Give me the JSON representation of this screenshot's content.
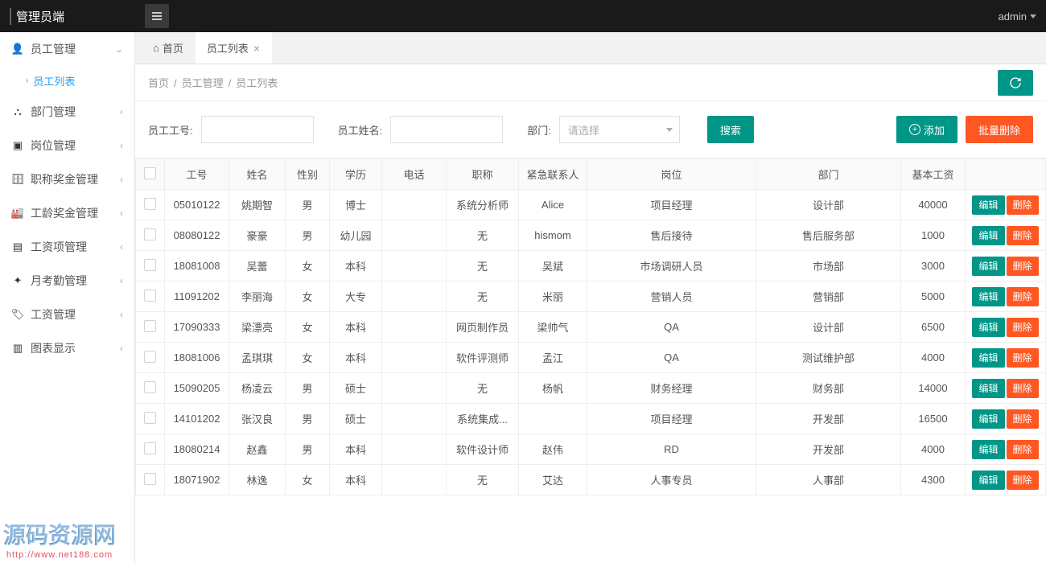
{
  "header": {
    "brand": "管理员端",
    "user": "admin"
  },
  "sidebar": {
    "items": [
      {
        "label": "员工管理",
        "expanded": true
      },
      {
        "label": "部门管理"
      },
      {
        "label": "岗位管理"
      },
      {
        "label": "职称奖金管理"
      },
      {
        "label": "工龄奖金管理"
      },
      {
        "label": "工资项管理"
      },
      {
        "label": "月考勤管理"
      },
      {
        "label": "工资管理"
      },
      {
        "label": "图表显示"
      }
    ],
    "sub": {
      "label": "员工列表"
    }
  },
  "tabs": {
    "home": "首页",
    "current": "员工列表"
  },
  "breadcrumb": {
    "a": "首页",
    "b": "员工管理",
    "c": "员工列表"
  },
  "filters": {
    "id_label": "员工工号:",
    "name_label": "员工姓名:",
    "dept_label": "部门:",
    "dept_placeholder": "请选择",
    "search": "搜索",
    "add": "添加",
    "batch_delete": "批量删除"
  },
  "table": {
    "headers": [
      "工号",
      "姓名",
      "性别",
      "学历",
      "电话",
      "职称",
      "紧急联系人",
      "岗位",
      "部门",
      "基本工资"
    ],
    "edit": "编辑",
    "delete": "删除",
    "rows": [
      {
        "c": [
          "05010122",
          "姚期智",
          "男",
          "博士",
          "",
          "系统分析师",
          "Alice",
          "项目经理",
          "设计部",
          "40000"
        ]
      },
      {
        "c": [
          "08080122",
          "豪豪",
          "男",
          "幼儿园",
          "",
          "无",
          "hismom",
          "售后接待",
          "售后服务部",
          "1000"
        ]
      },
      {
        "c": [
          "18081008",
          "吴蕾",
          "女",
          "本科",
          "",
          "无",
          "吴斌",
          "市场调研人员",
          "市场部",
          "3000"
        ]
      },
      {
        "c": [
          "11091202",
          "李丽海",
          "女",
          "大专",
          "",
          "无",
          "米丽",
          "营销人员",
          "营销部",
          "5000"
        ]
      },
      {
        "c": [
          "17090333",
          "梁漂亮",
          "女",
          "本科",
          "",
          "网页制作员",
          "梁帅气",
          "QA",
          "设计部",
          "6500"
        ]
      },
      {
        "c": [
          "18081006",
          "孟琪琪",
          "女",
          "本科",
          "",
          "软件评测师",
          "孟江",
          "QA",
          "测试维护部",
          "4000"
        ]
      },
      {
        "c": [
          "15090205",
          "杨凌云",
          "男",
          "硕士",
          "",
          "无",
          "杨帆",
          "财务经理",
          "财务部",
          "14000"
        ]
      },
      {
        "c": [
          "14101202",
          "张汉良",
          "男",
          "硕士",
          "",
          "系统集成...",
          "",
          "项目经理",
          "开发部",
          "16500"
        ]
      },
      {
        "c": [
          "18080214",
          "赵鑫",
          "男",
          "本科",
          "",
          "软件设计师",
          "赵伟",
          "RD",
          "开发部",
          "4000"
        ]
      },
      {
        "c": [
          "18071902",
          "林逸",
          "女",
          "本科",
          "",
          "无",
          "艾达",
          "人事专员",
          "人事部",
          "4300"
        ]
      }
    ]
  },
  "watermark": {
    "title": "源码资源网",
    "url": "http://www.net188.com"
  }
}
